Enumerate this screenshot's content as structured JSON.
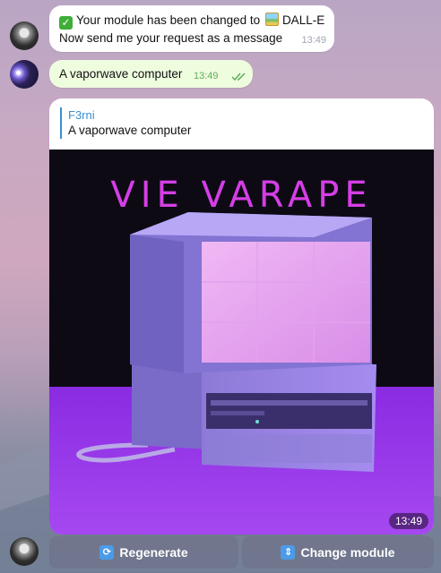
{
  "messages": {
    "bot_msg_1": {
      "prefix": "Your module has been changed to",
      "module": "DALL-E",
      "line2": "Now send me your request as a message",
      "time": "13:49"
    },
    "user_msg": {
      "text": "A vaporwave computer",
      "time": "13:49"
    },
    "bot_msg_2": {
      "reply_name": "F3rni",
      "reply_text": "A vaporwave computer",
      "image_text": "VIE VARAPE",
      "time": "13:49"
    }
  },
  "keyboard": {
    "regenerate": "Regenerate",
    "change_module": "Change module"
  },
  "colors": {
    "outgoing_bubble": "#effddf",
    "incoming_bubble": "#ffffff",
    "link_accent": "#3a8fd1",
    "image_title": "#d53ee6"
  },
  "icons": {
    "check": "check-mark-button-icon",
    "picture": "framed-picture-icon",
    "regenerate": "counterclockwise-arrows-icon",
    "change_module": "up-down-arrow-icon"
  }
}
